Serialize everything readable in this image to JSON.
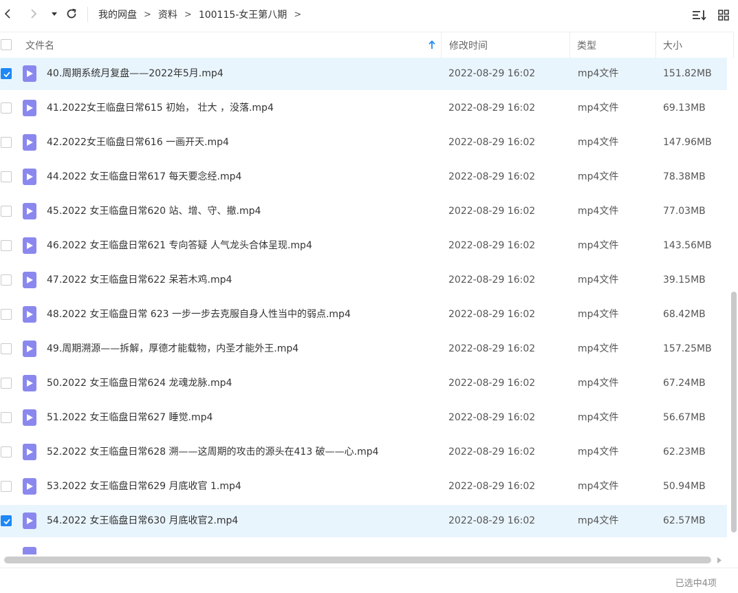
{
  "toolbar": {
    "breadcrumb": [
      "我的网盘",
      "资料",
      "100115-女王第八期"
    ],
    "separator": ">"
  },
  "table": {
    "columns": {
      "name": "文件名",
      "modified": "修改时间",
      "type": "类型",
      "size": "大小"
    },
    "sort": {
      "column": "name",
      "direction": "ascending"
    },
    "rows": [
      {
        "name": "40.周期系统月复盘——2022年5月.mp4",
        "modified": "2022-08-29 16:02",
        "type": "mp4文件",
        "size": "151.82MB",
        "selected": true
      },
      {
        "name": "41.2022女王临盘日常615 初始， 壮大 ，没落.mp4",
        "modified": "2022-08-29 16:02",
        "type": "mp4文件",
        "size": "69.13MB",
        "selected": false
      },
      {
        "name": "42.2022女王临盘日常616 一画开天.mp4",
        "modified": "2022-08-29 16:02",
        "type": "mp4文件",
        "size": "147.96MB",
        "selected": false
      },
      {
        "name": "44.2022 女王临盘日常617 每天要念经.mp4",
        "modified": "2022-08-29 16:02",
        "type": "mp4文件",
        "size": "78.38MB",
        "selected": false
      },
      {
        "name": "45.2022 女王临盘日常620 站、增、守、撤.mp4",
        "modified": "2022-08-29 16:02",
        "type": "mp4文件",
        "size": "77.03MB",
        "selected": false
      },
      {
        "name": "46.2022 女王临盘日常621 专向答疑 人气龙头合体呈现.mp4",
        "modified": "2022-08-29 16:02",
        "type": "mp4文件",
        "size": "143.56MB",
        "selected": false
      },
      {
        "name": "47.2022 女王临盘日常622 呆若木鸡.mp4",
        "modified": "2022-08-29 16:02",
        "type": "mp4文件",
        "size": "39.15MB",
        "selected": false
      },
      {
        "name": "48.2022 女王临盘日常 623 一步一步去克服自身人性当中的弱点.mp4",
        "modified": "2022-08-29 16:02",
        "type": "mp4文件",
        "size": "68.42MB",
        "selected": false
      },
      {
        "name": "49.周期溯源——拆解，厚德才能载物，内圣才能外王.mp4",
        "modified": "2022-08-29 16:02",
        "type": "mp4文件",
        "size": "157.25MB",
        "selected": false
      },
      {
        "name": "50.2022 女王临盘日常624 龙魂龙脉.mp4",
        "modified": "2022-08-29 16:02",
        "type": "mp4文件",
        "size": "67.24MB",
        "selected": false
      },
      {
        "name": "51.2022 女王临盘日常627 睡觉.mp4",
        "modified": "2022-08-29 16:02",
        "type": "mp4文件",
        "size": "56.67MB",
        "selected": false
      },
      {
        "name": "52.2022 女王临盘日常628 溯——这周期的攻击的源头在413 破——心.mp4",
        "modified": "2022-08-29 16:02",
        "type": "mp4文件",
        "size": "62.23MB",
        "selected": false
      },
      {
        "name": "53.2022 女王临盘日常629 月底收官 1.mp4",
        "modified": "2022-08-29 16:02",
        "type": "mp4文件",
        "size": "50.94MB",
        "selected": false
      },
      {
        "name": "54.2022 女王临盘日常630 月底收官2.mp4",
        "modified": "2022-08-29 16:02",
        "type": "mp4文件",
        "size": "62.57MB",
        "selected": true
      }
    ]
  },
  "colors": {
    "accent": "#1e88f5",
    "selected_row": "#e9f5fd",
    "file_icon": "#8a88ee"
  },
  "icons": {
    "back": "chevron-left-icon",
    "forward": "chevron-right-icon",
    "history": "caret-down-icon",
    "refresh": "refresh-icon",
    "sort": "sort-icon",
    "grid_view": "grid-view-icon",
    "file": "video-file-icon"
  },
  "status": {
    "selection": "已选中4项"
  }
}
